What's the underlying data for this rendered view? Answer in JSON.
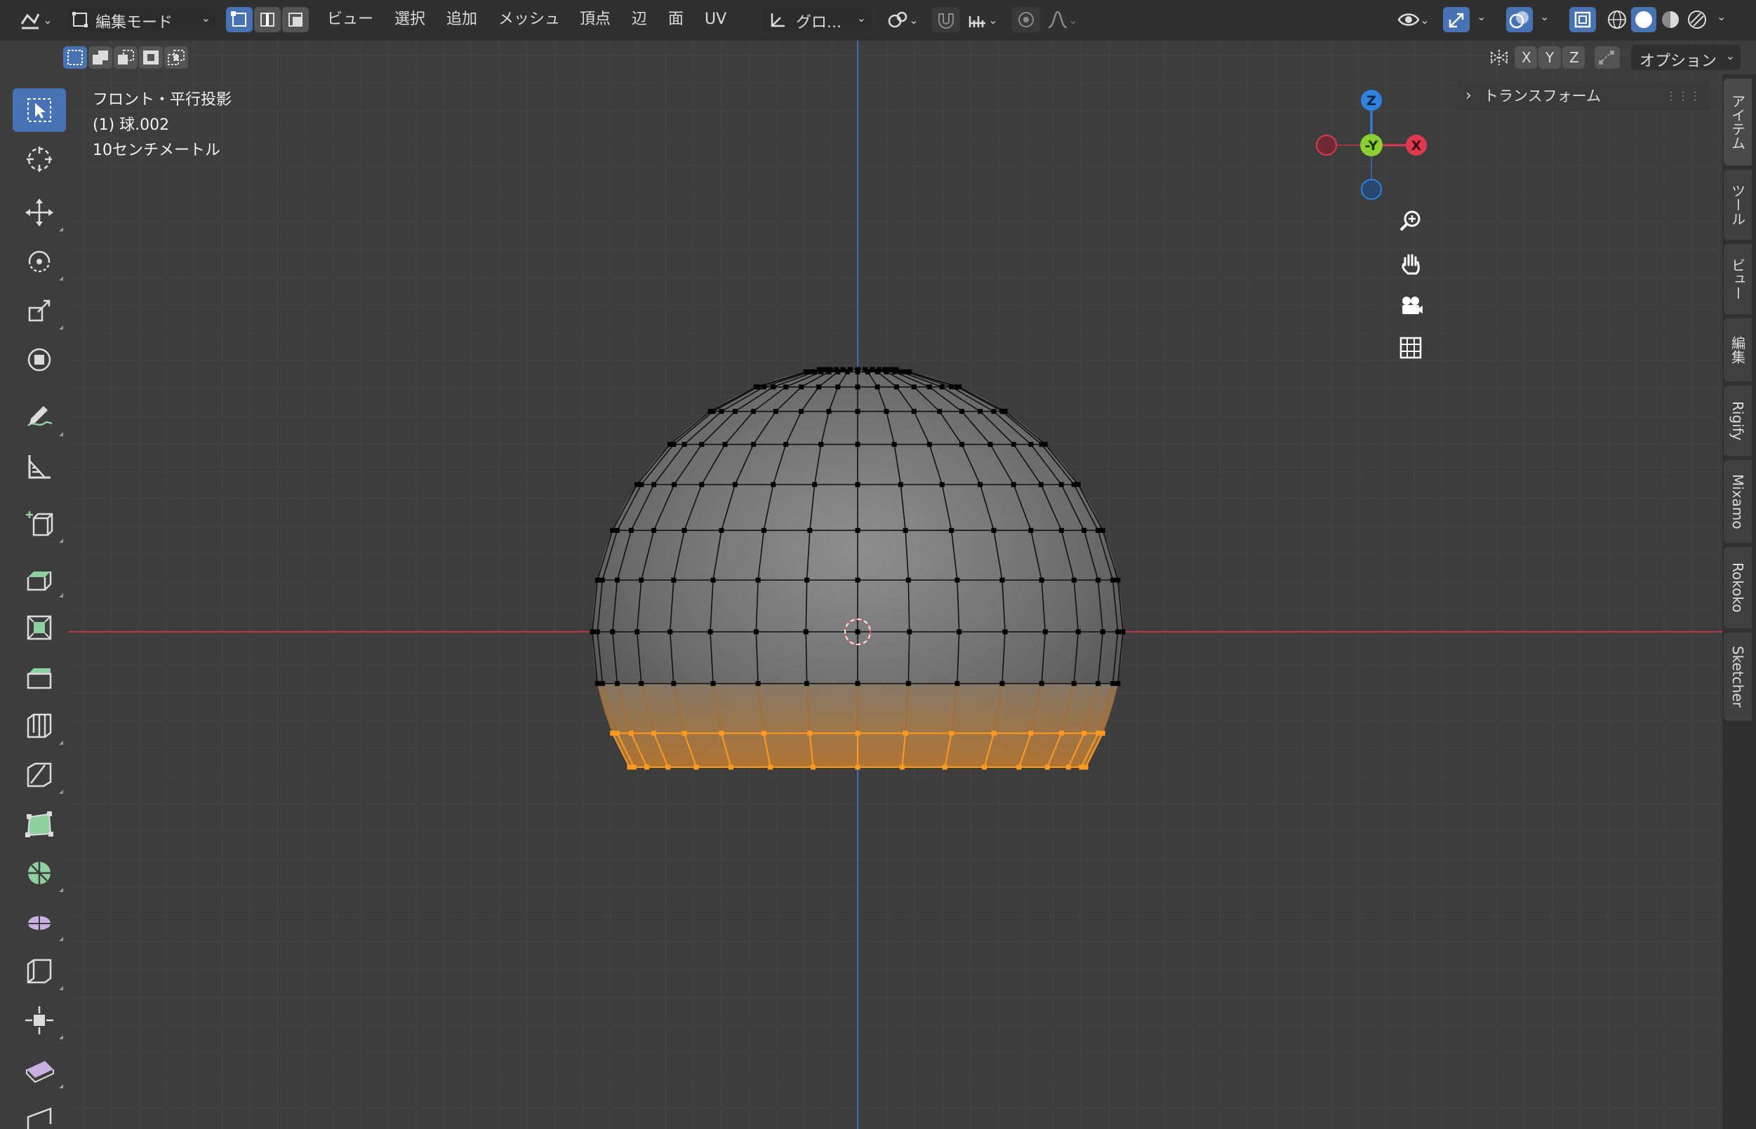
{
  "header": {
    "editor_type_icon": "object-data-icon",
    "mode_label": "編集モード",
    "menus": [
      "ビュー",
      "選択",
      "追加",
      "メッシュ",
      "頂点",
      "辺",
      "面",
      "UV"
    ],
    "transform_orientation": "グロ...",
    "options_label": "オプション",
    "axis_x": "X",
    "axis_y": "Y",
    "axis_z": "Z"
  },
  "viewport": {
    "view_name": "フロント・平行投影",
    "object_name": "(1) 球.002",
    "scale_text": "10センチメートル"
  },
  "gizmo": {
    "z_label": "Z",
    "y_label": "-Y",
    "x_label": "X"
  },
  "npanel": {
    "transform_header": "トランスフォーム"
  },
  "sidebar_tabs": [
    "アイテム",
    "ツール",
    "ビュー",
    "編集",
    "Rigify",
    "Mixamo",
    "Rokoko",
    "Sketcher"
  ],
  "colors": {
    "active_blue": "#4772b3",
    "selection_orange": "#ff9a1f",
    "axis_red": "#b43c46",
    "axis_blue": "#3c6eb4",
    "gizmo_x": "#e0384f",
    "gizmo_y": "#8bd030",
    "gizmo_z": "#2f82e0"
  }
}
